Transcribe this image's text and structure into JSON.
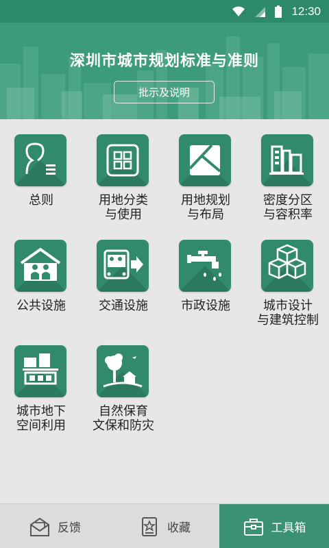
{
  "status_bar": {
    "time": "12:30"
  },
  "header": {
    "title": "深圳市城市规划标准与准则",
    "subtitle_button": "批示及说明"
  },
  "categories": [
    {
      "label_line1": "总则",
      "label_line2": "",
      "icon": "person-document-icon"
    },
    {
      "label_line1": "用地分类",
      "label_line2": "与使用",
      "icon": "grid-squares-icon"
    },
    {
      "label_line1": "用地规划",
      "label_line2": "与布局",
      "icon": "land-plot-icon"
    },
    {
      "label_line1": "密度分区",
      "label_line2": "与容积率",
      "icon": "buildings-icon"
    },
    {
      "label_line1": "公共设施",
      "label_line2": "",
      "icon": "people-house-icon"
    },
    {
      "label_line1": "交通设施",
      "label_line2": "",
      "icon": "bus-icon"
    },
    {
      "label_line1": "市政设施",
      "label_line2": "",
      "icon": "faucet-icon"
    },
    {
      "label_line1": "城市设计",
      "label_line2": "与建筑控制",
      "icon": "cubes-icon"
    },
    {
      "label_line1": "城市地下",
      "label_line2": "空间利用",
      "icon": "underground-building-icon"
    },
    {
      "label_line1": "自然保育",
      "label_line2": "文保和防灾",
      "icon": "tree-house-icon"
    }
  ],
  "bottom_nav": {
    "feedback": "反馈",
    "favorites": "收藏",
    "toolbox": "工具箱"
  },
  "colors": {
    "primary": "#3c9c7a",
    "icon_bg": "#318a6b",
    "active_tab": "#3a9272"
  }
}
